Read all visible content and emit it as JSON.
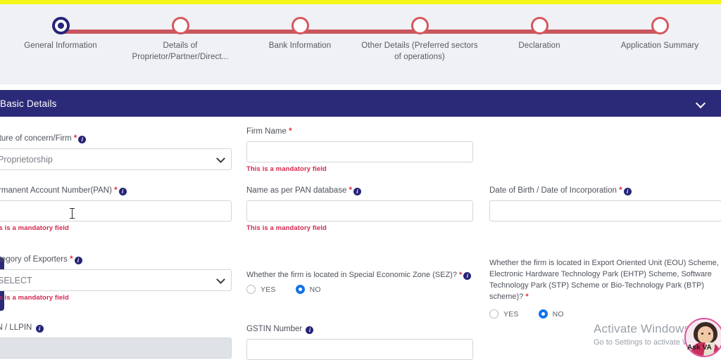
{
  "stepper": {
    "steps": [
      {
        "label": "General Information",
        "state": "active"
      },
      {
        "label": "Details of Proprietor/Partner/Direct...",
        "state": "pending"
      },
      {
        "label": "Bank Information",
        "state": "pending"
      },
      {
        "label": "Other Details (Preferred sectors of operations)",
        "state": "pending"
      },
      {
        "label": "Declaration",
        "state": "pending"
      },
      {
        "label": "Application Summary",
        "state": "pending"
      }
    ],
    "track_color": "#c9565f",
    "active_color": "#26237a",
    "pending_color": "#d6575f"
  },
  "section": {
    "title": "Basic Details",
    "bg_color": "#2b2a78",
    "collapse_icon": "chevron-down-icon"
  },
  "mandatory_message": "This is a mandatory field",
  "fields": {
    "nature_of_concern": {
      "label": "Nature of concern/Firm",
      "required": true,
      "value": "Proprietorship",
      "options": [
        "Proprietorship"
      ]
    },
    "firm_name": {
      "label": "Firm Name",
      "required": true,
      "value": "",
      "error": "This is a mandatory field"
    },
    "pan": {
      "label": "Permanent Account Number(PAN)",
      "required": true,
      "value": "",
      "error": "This is a mandatory field"
    },
    "name_as_per_pan": {
      "label": "Name as per PAN database",
      "required": true,
      "value": "",
      "error": "This is a mandatory field"
    },
    "date_of_birth": {
      "label": "Date of Birth / Date of Incorporation",
      "required": true,
      "value": ""
    },
    "category_of_exporters": {
      "label": "Category of Exporters",
      "required": true,
      "value": "SELECT",
      "options": [
        "SELECT"
      ],
      "error": "This is a mandatory field"
    },
    "sez": {
      "label": "Whether the firm is located in Special Economic Zone (SEZ)?",
      "required": true,
      "options": [
        "YES",
        "NO"
      ],
      "selected": "NO"
    },
    "eou": {
      "label": "Whether the firm is located in Export Oriented Unit (EOU) Scheme, Electronic Hardware Technology Park (EHTP) Scheme, Software Technology Park (STP) Scheme or Bio-Technology Park (BTP) scheme)?",
      "required": true,
      "options": [
        "YES",
        "NO"
      ],
      "selected": "NO"
    },
    "cin_llpin": {
      "label": "CIN / LLPIN",
      "required": false,
      "value": "",
      "disabled": true
    },
    "gstin": {
      "label": "GSTIN Number",
      "required": false,
      "value": ""
    }
  },
  "watermark": {
    "line1": "Activate Windows",
    "line2": "Go to Settings to activate Windows"
  },
  "assistant": {
    "label": "Ask VA",
    "icon": "avatar-icon"
  }
}
